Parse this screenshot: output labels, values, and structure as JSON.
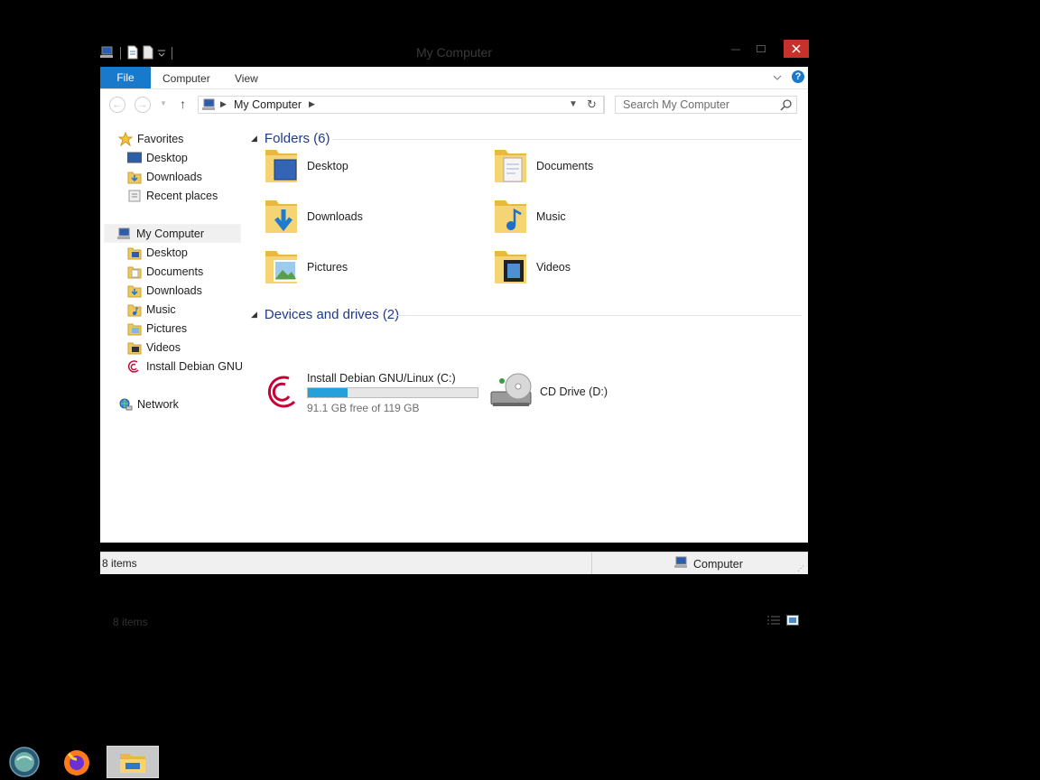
{
  "window": {
    "title": "My Computer"
  },
  "ribbon": {
    "file": "File",
    "tabs": [
      "Computer",
      "View"
    ],
    "help": "?"
  },
  "address": {
    "path": "My Computer"
  },
  "search": {
    "placeholder": "Search My Computer"
  },
  "nav": {
    "favorites": {
      "label": "Favorites",
      "items": [
        "Desktop",
        "Downloads",
        "Recent places"
      ]
    },
    "computer": {
      "label": "My Computer",
      "items": [
        "Desktop",
        "Documents",
        "Downloads",
        "Music",
        "Pictures",
        "Videos",
        "Install Debian GNU/Linux (C:)"
      ]
    },
    "network": {
      "label": "Network"
    }
  },
  "folders": {
    "header": "Folders (6)",
    "items": [
      "Desktop",
      "Documents",
      "Downloads",
      "Music",
      "Pictures",
      "Videos"
    ]
  },
  "devices": {
    "header": "Devices and drives (2)",
    "drive_c": {
      "label": "Install Debian GNU/Linux (C:)",
      "free": "91.1 GB free of 119 GB",
      "used_fraction": 0.234
    },
    "drive_d": {
      "label": "CD Drive (D:)"
    }
  },
  "status": {
    "count": "8 items",
    "bar_count": "8 items",
    "location": "Computer"
  },
  "colors": {
    "accent": "#1979ca",
    "close": "#c7312b",
    "drive_fill": "#26a0da",
    "group_header": "#1e3a8f"
  },
  "icons": [
    "computer-icon",
    "folder-icon",
    "debian-icon",
    "cd-drive-icon",
    "star-icon",
    "network-icon",
    "firefox-icon",
    "explorer-icon"
  ]
}
